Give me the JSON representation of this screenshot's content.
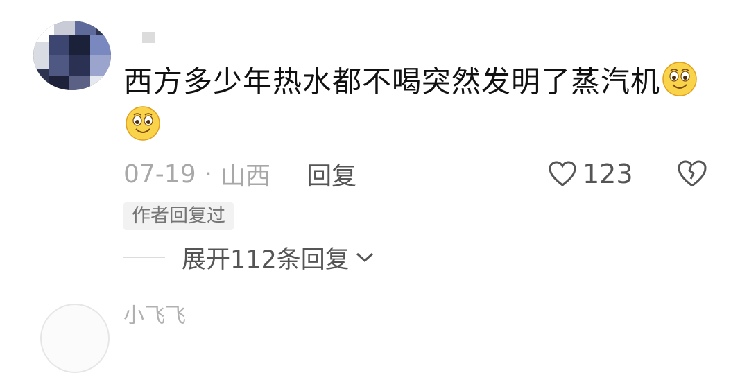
{
  "comment": {
    "avatar_icon": "blurred-avatar",
    "username": "",
    "text": "西方多少年热水都不喝突然发明了蒸汽机",
    "emoji_icon": "smile-emoji",
    "date": "07-19",
    "separator": "·",
    "location": "山西",
    "reply_label": "回复",
    "like_icon": "heart-outline-icon",
    "like_count": "123",
    "dislike_icon": "broken-heart-icon",
    "author_badge": "作者回复过",
    "expand_label": "展开112条回复",
    "expand_icon": "chevron-down-icon"
  },
  "next_comment": {
    "username": "小飞飞"
  }
}
